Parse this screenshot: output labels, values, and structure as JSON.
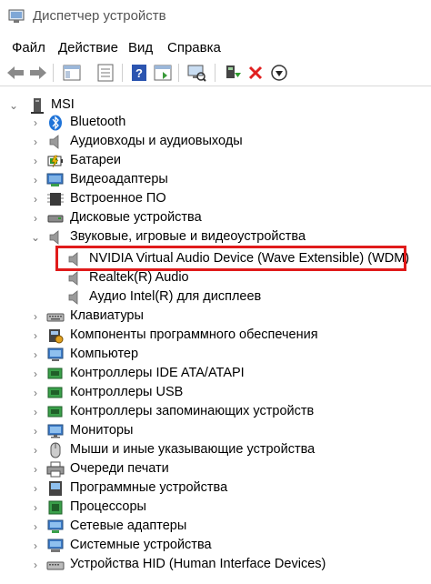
{
  "window": {
    "title": "Диспетчер устройств"
  },
  "menu": [
    "Файл",
    "Действие",
    "Вид",
    "Справка"
  ],
  "toolbar": {
    "buttons": [
      "back-arrow-icon",
      "forward-arrow-icon",
      "properties-panel-icon",
      "list-view-icon",
      "help-icon",
      "console-icon",
      "monitor-scan-icon",
      "update-driver-icon",
      "remove-device-icon",
      "disable-device-icon"
    ]
  },
  "tree": {
    "root": "MSI",
    "items": [
      {
        "label": "Bluetooth",
        "icon": "bluetooth-icon"
      },
      {
        "label": "Аудиовходы и аудиовыходы",
        "icon": "speaker-icon"
      },
      {
        "label": "Батареи",
        "icon": "battery-icon"
      },
      {
        "label": "Видеоадаптеры",
        "icon": "display-adapter-icon"
      },
      {
        "label": "Встроенное ПО",
        "icon": "firmware-icon"
      },
      {
        "label": "Дисковые устройства",
        "icon": "disk-drive-icon"
      },
      {
        "label": "Звуковые, игровые и видеоустройства",
        "icon": "speaker-icon",
        "expanded": true,
        "children": [
          "NVIDIA Virtual Audio Device (Wave Extensible) (WDM)",
          "Realtek(R) Audio",
          "Аудио Intel(R) для дисплеев"
        ]
      },
      {
        "label": "Клавиатуры",
        "icon": "keyboard-icon"
      },
      {
        "label": "Компоненты программного обеспечения",
        "icon": "software-component-icon"
      },
      {
        "label": "Компьютер",
        "icon": "computer-icon"
      },
      {
        "label": "Контроллеры IDE ATA/ATAPI",
        "icon": "ide-controller-icon"
      },
      {
        "label": "Контроллеры USB",
        "icon": "usb-controller-icon"
      },
      {
        "label": "Контроллеры запоминающих устройств",
        "icon": "storage-controller-icon"
      },
      {
        "label": "Мониторы",
        "icon": "monitor-icon"
      },
      {
        "label": "Мыши и иные указывающие устройства",
        "icon": "mouse-icon"
      },
      {
        "label": "Очереди печати",
        "icon": "printer-icon"
      },
      {
        "label": "Программные устройства",
        "icon": "software-device-icon"
      },
      {
        "label": "Процессоры",
        "icon": "processor-icon"
      },
      {
        "label": "Сетевые адаптеры",
        "icon": "network-adapter-icon"
      },
      {
        "label": "Системные устройства",
        "icon": "system-device-icon"
      },
      {
        "label": "Устройства HID (Human Interface Devices)",
        "icon": "hid-icon"
      }
    ]
  },
  "colors": {
    "highlight": "#e01b1b",
    "bluetooth": "#1e73d8",
    "accent": "#2f6fb5"
  }
}
